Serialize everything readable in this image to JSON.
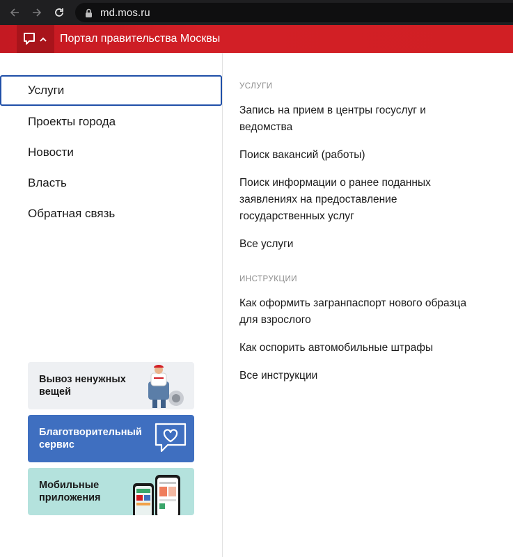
{
  "browser": {
    "url": "md.mos.ru"
  },
  "header": {
    "title": "Портал правительства Москвы",
    "brand_color": "#d21f26"
  },
  "nav": {
    "items": [
      {
        "label": "Услуги",
        "active": true
      },
      {
        "label": "Проекты города"
      },
      {
        "label": "Новости"
      },
      {
        "label": "Власть"
      },
      {
        "label": "Обратная связь"
      }
    ]
  },
  "promos": [
    {
      "line1": "Вывоз ненужных",
      "line2": "вещей"
    },
    {
      "line1": "Благотворительный",
      "line2": "сервис"
    },
    {
      "line1": "Мобильные",
      "line2": "приложения"
    }
  ],
  "services": {
    "heading": "УСЛУГИ",
    "links": [
      {
        "line1": "Запись на прием в центры госуслуг и",
        "line2": "ведомства"
      },
      {
        "line1": "Поиск вакансий (работы)"
      },
      {
        "line1": "Поиск информации о ранее поданных",
        "line2": "заявлениях на предоставление",
        "line3": "государственных услуг"
      },
      {
        "line1": "Все услуги"
      }
    ]
  },
  "instructions": {
    "heading": "ИНСТРУКЦИИ",
    "links": [
      {
        "line1": "Как оформить загранпаспорт нового образца",
        "line2": "для взрослого"
      },
      {
        "line1": "Как оспорить автомобильные штрафы"
      },
      {
        "line1": "Все инструкции"
      }
    ]
  }
}
